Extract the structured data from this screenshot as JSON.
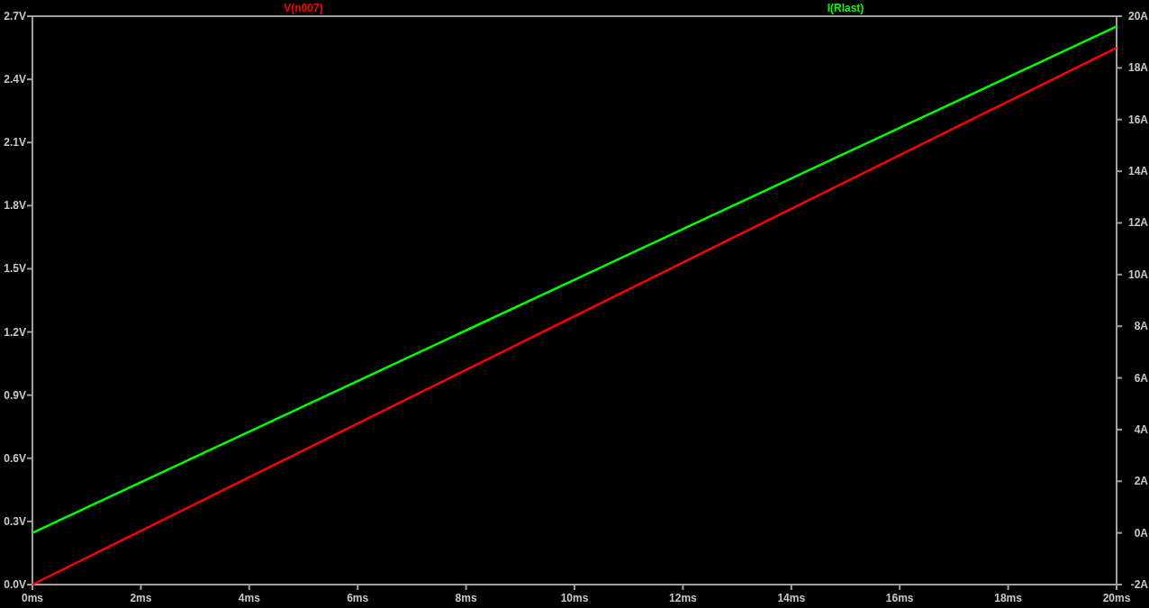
{
  "chart_data": {
    "type": "line",
    "x": [
      0,
      10,
      20
    ],
    "series": [
      {
        "name": "V(n007)",
        "color": "#ff0000",
        "values": [
          0,
          1.275,
          2.55
        ]
      },
      {
        "name": "I(Rlast)",
        "color": "#00ff00",
        "axis": "y2",
        "values": [
          0,
          9.8,
          19.6
        ]
      }
    ],
    "xlim": [
      0,
      20
    ],
    "ylim": [
      0,
      2.7
    ],
    "y2lim": [
      -2,
      20
    ],
    "xticks": [
      {
        "value": 0,
        "label": "0ms"
      },
      {
        "value": 2,
        "label": "2ms"
      },
      {
        "value": 4,
        "label": "4ms"
      },
      {
        "value": 6,
        "label": "6ms"
      },
      {
        "value": 8,
        "label": "8ms"
      },
      {
        "value": 10,
        "label": "10ms"
      },
      {
        "value": 12,
        "label": "12ms"
      },
      {
        "value": 14,
        "label": "14ms"
      },
      {
        "value": 16,
        "label": "16ms"
      },
      {
        "value": 18,
        "label": "18ms"
      },
      {
        "value": 20,
        "label": "20ms"
      }
    ],
    "yticks": [
      {
        "value": 0,
        "label": "0.0V"
      },
      {
        "value": 0.3,
        "label": "0.3V"
      },
      {
        "value": 0.6,
        "label": "0.6V"
      },
      {
        "value": 0.9,
        "label": "0.9V"
      },
      {
        "value": 1.2,
        "label": "1.2V"
      },
      {
        "value": 1.5,
        "label": "1.5V"
      },
      {
        "value": 1.8,
        "label": "1.8V"
      },
      {
        "value": 2.1,
        "label": "2.1V"
      },
      {
        "value": 2.4,
        "label": "2.4V"
      },
      {
        "value": 2.7,
        "label": "2.7V"
      }
    ],
    "y2ticks": [
      {
        "value": -2,
        "label": "-2A"
      },
      {
        "value": 0,
        "label": "0A"
      },
      {
        "value": 2,
        "label": "2A"
      },
      {
        "value": 4,
        "label": "4A"
      },
      {
        "value": 6,
        "label": "6A"
      },
      {
        "value": 8,
        "label": "8A"
      },
      {
        "value": 10,
        "label": "10A"
      },
      {
        "value": 12,
        "label": "12A"
      },
      {
        "value": 14,
        "label": "14A"
      },
      {
        "value": 16,
        "label": "16A"
      },
      {
        "value": 18,
        "label": "18A"
      },
      {
        "value": 20,
        "label": "20A"
      }
    ]
  }
}
